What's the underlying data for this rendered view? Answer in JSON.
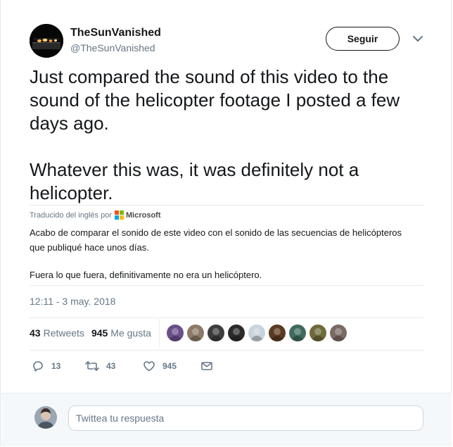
{
  "author": {
    "name": "TheSunVanished",
    "handle": "@TheSunVanished",
    "avatar_icon": "city-lights-night-avatar"
  },
  "header": {
    "follow_label": "Seguir",
    "more_icon": "chevron-down-icon"
  },
  "tweet": {
    "paragraphs": [
      "Just compared the sound of this video to the sound of the helicopter footage I posted a few days ago.",
      "Whatever this was, it was definitely not a helicopter."
    ]
  },
  "translation": {
    "label": "Traducido del inglés por",
    "provider": "Microsoft",
    "provider_colors": [
      "#f25022",
      "#7fba00",
      "#00a4ef",
      "#ffb900"
    ],
    "paragraphs": [
      "Acabo de comparar el sonido de este video con el sonido de las secuencias de helicópteros que publiqué hace unos días.",
      "Fuera lo que fuera, definitivamente no era un helicóptero."
    ]
  },
  "timestamp": "12:11 - 3 may. 2018",
  "stats": {
    "retweets_count": "43",
    "retweets_label": "Retweets",
    "likes_count": "945",
    "likes_label": "Me gusta"
  },
  "likers": [
    {
      "color": "#6b4f8a"
    },
    {
      "color": "#8a7a66"
    },
    {
      "color": "#3d3d3d"
    },
    {
      "color": "#2b2b2b"
    },
    {
      "color": "#c9d3db"
    },
    {
      "color": "#5a3a22"
    },
    {
      "color": "#3f6b5e"
    },
    {
      "color": "#6e6a3a"
    },
    {
      "color": "#7a6a66"
    }
  ],
  "actions": {
    "reply_count": "13",
    "retweet_count": "43",
    "like_count": "945"
  },
  "reply": {
    "placeholder": "Twittea tu respuesta"
  },
  "colors": {
    "text": "#14171a",
    "muted": "#657786",
    "border": "#e6ecf0",
    "reply_bg": "#f5f8fa"
  }
}
